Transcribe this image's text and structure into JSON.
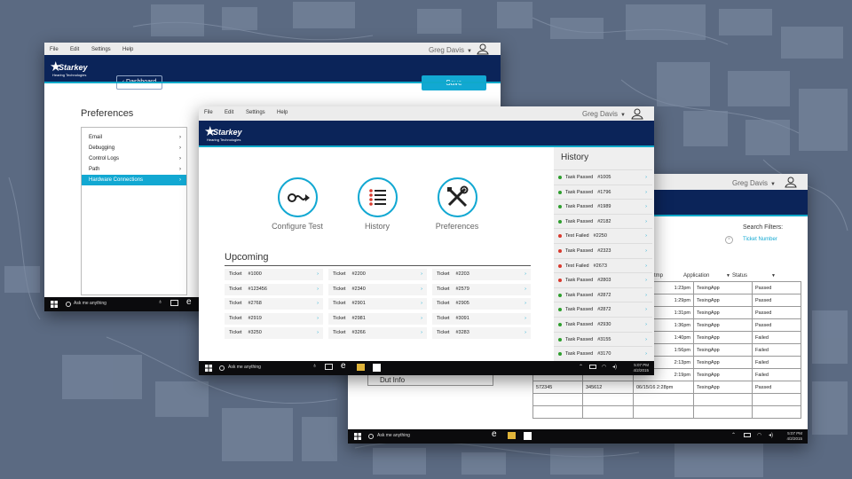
{
  "colors": {
    "navy": "#0b2459",
    "accent": "#12a8d2",
    "pass": "#2e9e2e",
    "fail": "#d83a2e"
  },
  "menu": [
    "File",
    "Edit",
    "Settings",
    "Help"
  ],
  "user_name": "Greg Davis",
  "brand": {
    "name": "Starkey",
    "tagline": "Hearing Technologies"
  },
  "taskbar": {
    "search": "Ask me anything",
    "time": "5:07 PM",
    "date": "4/2/2015"
  },
  "win1": {
    "dashboard_label": "Dashboard",
    "save_label": "Save",
    "preferences_title": "Preferences",
    "pref_items": [
      {
        "label": "Email"
      },
      {
        "label": "Debugging"
      },
      {
        "label": "Control Logs"
      },
      {
        "label": "Path"
      },
      {
        "label": "Hardware Connections"
      }
    ]
  },
  "win2": {
    "features": [
      {
        "label": "Configure Test",
        "icon": "configure-test-icon"
      },
      {
        "label": "History",
        "icon": "list-icon"
      },
      {
        "label": "Preferences",
        "icon": "tools-icon"
      }
    ],
    "upcoming_title": "Upcoming",
    "tickets": [
      {
        "label": "Ticket",
        "number": "#1000"
      },
      {
        "label": "Ticket",
        "number": "#2200"
      },
      {
        "label": "Ticket",
        "number": "#2203"
      },
      {
        "label": "Ticket",
        "number": "#123456"
      },
      {
        "label": "Ticket",
        "number": "#2340"
      },
      {
        "label": "Ticket",
        "number": "#2579"
      },
      {
        "label": "Ticket",
        "number": "#2768"
      },
      {
        "label": "Ticket",
        "number": "#2901"
      },
      {
        "label": "Ticket",
        "number": "#2905"
      },
      {
        "label": "Ticket",
        "number": "#2919"
      },
      {
        "label": "Ticket",
        "number": "#2981"
      },
      {
        "label": "Ticket",
        "number": "#3091"
      },
      {
        "label": "Ticket",
        "number": "#3250"
      },
      {
        "label": "Ticket",
        "number": "#3266"
      },
      {
        "label": "Ticket",
        "number": "#3283"
      }
    ],
    "history_title": "History",
    "history": [
      {
        "status": "Task Passed",
        "number": "#1005",
        "result": "pass"
      },
      {
        "status": "Task Passed",
        "number": "#1796",
        "result": "pass"
      },
      {
        "status": "Task Passed",
        "number": "#1989",
        "result": "pass"
      },
      {
        "status": "Task Passed",
        "number": "#2182",
        "result": "pass"
      },
      {
        "status": "Test Failed",
        "number": "#2250",
        "result": "fail"
      },
      {
        "status": "Task Passed",
        "number": "#2323",
        "result": "fail"
      },
      {
        "status": "Test Failed",
        "number": "#2673",
        "result": "fail"
      },
      {
        "status": "Task Passed",
        "number": "#2803",
        "result": "fail"
      },
      {
        "status": "Task Passed",
        "number": "#2872",
        "result": "pass"
      },
      {
        "status": "Task Passed",
        "number": "#2872",
        "result": "pass"
      },
      {
        "status": "Task Passed",
        "number": "#2930",
        "result": "pass"
      },
      {
        "status": "Task Passed",
        "number": "#3155",
        "result": "pass"
      },
      {
        "status": "Task Passed",
        "number": "#3170",
        "result": "pass"
      }
    ]
  },
  "win3": {
    "search_filters": "Search Filters:",
    "filter_link": "Ticket Number",
    "col_stamp": "tmp",
    "col_application": "Application",
    "col_status": "Status",
    "rows": [
      {
        "a": "",
        "b": "",
        "time": "1:23pm",
        "app": "TesingApp",
        "status": "Passed"
      },
      {
        "a": "",
        "b": "",
        "time": "1:29pm",
        "app": "TesingApp",
        "status": "Passed"
      },
      {
        "a": "",
        "b": "",
        "time": "1:31pm",
        "app": "TesingApp",
        "status": "Passed"
      },
      {
        "a": "",
        "b": "",
        "time": "1:36pm",
        "app": "TesingApp",
        "status": "Passed"
      },
      {
        "a": "",
        "b": "",
        "time": "1:40pm",
        "app": "TesingApp",
        "status": "Failed"
      },
      {
        "a": "",
        "b": "",
        "time": "1:56pm",
        "app": "TesingApp",
        "status": "Failed"
      },
      {
        "a": "",
        "b": "",
        "time": "2:13pm",
        "app": "TesingApp",
        "status": "Failed"
      },
      {
        "a": "",
        "b": "",
        "time": "2:19pm",
        "app": "TesingApp",
        "status": "Failed"
      },
      {
        "a": "572345",
        "b": "345612",
        "time": "06/15/16 2:28pm",
        "app": "TesingApp",
        "status": "Passed"
      },
      {
        "a": "",
        "b": "",
        "time": "",
        "app": "",
        "status": ""
      },
      {
        "a": "",
        "b": "",
        "time": "",
        "app": "",
        "status": ""
      }
    ],
    "dut_info": "Dut Info"
  }
}
